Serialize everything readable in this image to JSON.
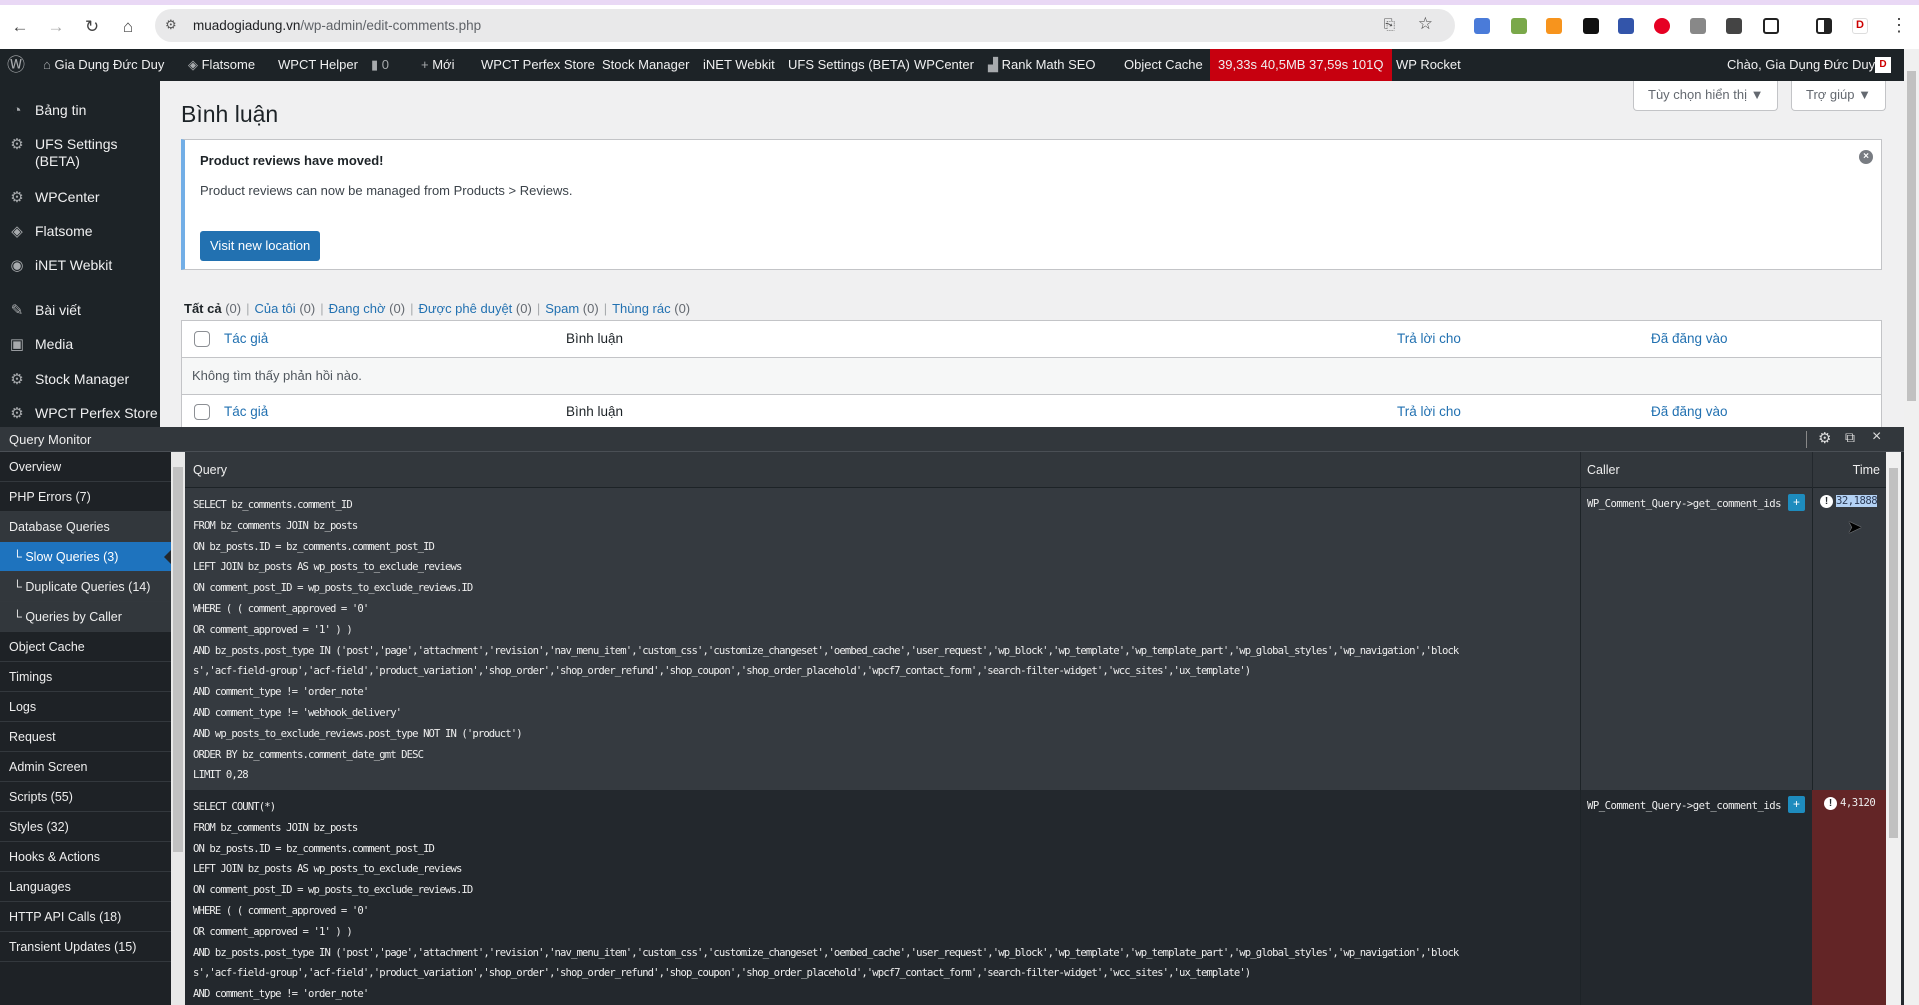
{
  "browser": {
    "url_host": "muadogiadung.vn",
    "url_path": "/wp-admin/edit-comments.php"
  },
  "adminbar": {
    "site": "Gia Dụng Đức Duy",
    "items": [
      "Flatsome",
      "WPCT Helper",
      "0",
      "Mới",
      "WPCT Perfex Store",
      "Stock Manager",
      "iNET Webkit",
      "UFS Settings (BETA)",
      "WPCenter",
      "Rank Math SEO",
      "Object Cache"
    ],
    "qm_stats": "39,33s  40,5MB  37,59s  101Q",
    "rocket": "WP Rocket",
    "greeting": "Chào, Gia Dụng Đức Duy",
    "qm_color": "#c7000f"
  },
  "sidebar": {
    "items": [
      {
        "label": "Bảng tin",
        "icon": "dashboard-icon"
      },
      {
        "label": "UFS Settings (BETA)",
        "icon": "gear-icon"
      },
      {
        "label": "WPCenter",
        "icon": "gear-icon"
      },
      {
        "label": "Flatsome",
        "icon": "flatsome-icon"
      },
      {
        "label": "iNET Webkit",
        "icon": "inet-icon"
      },
      {
        "label": "Bài viết",
        "icon": "pin-icon"
      },
      {
        "label": "Media",
        "icon": "media-icon"
      },
      {
        "label": "Stock Manager",
        "icon": "gear-icon"
      },
      {
        "label": "WPCT Perfex Store",
        "icon": "gear-icon"
      }
    ]
  },
  "page": {
    "title": "Bình luận",
    "screen_options": "Tùy chọn hiển thị ▼",
    "help": "Trợ giúp ▼"
  },
  "notice": {
    "heading": "Product reviews have moved!",
    "text": "Product reviews can now be managed from Products > Reviews.",
    "button": "Visit new location"
  },
  "filters": {
    "all": "Tất cả",
    "all_count": "(0)",
    "links": [
      {
        "label": "Của tôi",
        "count": "(0)"
      },
      {
        "label": "Đang chờ",
        "count": "(0)"
      },
      {
        "label": "Được phê duyệt",
        "count": "(0)"
      },
      {
        "label": "Spam",
        "count": "(0)"
      },
      {
        "label": "Thùng rác",
        "count": "(0)"
      }
    ]
  },
  "table": {
    "columns": [
      "Tác giả",
      "Bình luận",
      "Trả lời cho",
      "Đã đăng vào"
    ],
    "empty": "Không tìm thấy phản hồi nào."
  },
  "qm": {
    "title": "Query Monitor",
    "nav": [
      {
        "label": "Overview"
      },
      {
        "label": "PHP Errors (7)"
      },
      {
        "label": "Database Queries"
      },
      {
        "label": "└ Slow Queries (3)",
        "active": true
      },
      {
        "label": "└ Duplicate Queries (14)"
      },
      {
        "label": "└ Queries by Caller"
      },
      {
        "label": "Object Cache"
      },
      {
        "label": "Timings"
      },
      {
        "label": "Logs"
      },
      {
        "label": "Request"
      },
      {
        "label": "Admin Screen"
      },
      {
        "label": "Scripts (55)"
      },
      {
        "label": "Styles (32)"
      },
      {
        "label": "Hooks & Actions"
      },
      {
        "label": "Languages"
      },
      {
        "label": "HTTP API Calls (18)"
      },
      {
        "label": "Transient Updates (15)"
      }
    ],
    "columns": {
      "query": "Query",
      "caller": "Caller",
      "time": "Time"
    },
    "rows": [
      {
        "caller": "WP_Comment_Query->get_comment_ids",
        "time": "32,1888",
        "sql": [
          "SELECT bz_comments.comment_ID",
          "FROM bz_comments JOIN bz_posts",
          "ON bz_posts.ID = bz_comments.comment_post_ID",
          "LEFT JOIN bz_posts AS wp_posts_to_exclude_reviews",
          "ON comment_post_ID = wp_posts_to_exclude_reviews.ID",
          "WHERE ( ( comment_approved = '0'",
          "OR comment_approved = '1' ) )",
          "AND bz_posts.post_type IN ('post','page','attachment','revision','nav_menu_item','custom_css','customize_changeset','oembed_cache','user_request','wp_block','wp_template','wp_template_part','wp_global_styles','wp_navigation','block",
          "s','acf-field-group','acf-field','product_variation','shop_order','shop_order_refund','shop_coupon','shop_order_placehold','wpcf7_contact_form','search-filter-widget','wcc_sites','ux_template')",
          "AND comment_type != 'order_note'",
          "AND comment_type != 'webhook_delivery'",
          "AND wp_posts_to_exclude_reviews.post_type NOT IN ('product')",
          "ORDER BY bz_comments.comment_date_gmt DESC",
          "LIMIT 0,28"
        ]
      },
      {
        "caller": "WP_Comment_Query->get_comment_ids",
        "time": "4,3120",
        "sql": [
          "SELECT COUNT(*)",
          "FROM bz_comments JOIN bz_posts",
          "ON bz_posts.ID = bz_comments.comment_post_ID",
          "LEFT JOIN bz_posts AS wp_posts_to_exclude_reviews",
          "ON comment_post_ID = wp_posts_to_exclude_reviews.ID",
          "WHERE ( ( comment_approved = '0'",
          "OR comment_approved = '1' ) )",
          "AND bz_posts.post_type IN ('post','page','attachment','revision','nav_menu_item','custom_css','customize_changeset','oembed_cache','user_request','wp_block','wp_template','wp_template_part','wp_global_styles','wp_navigation','block",
          "s','acf-field-group','acf-field','product_variation','shop_order','shop_order_refund','shop_coupon','shop_order_placehold','wpcf7_contact_form','search-filter-widget','wcc_sites','ux_template')",
          "AND comment_type != 'order_note'"
        ]
      }
    ],
    "slow_color": "#632526"
  }
}
